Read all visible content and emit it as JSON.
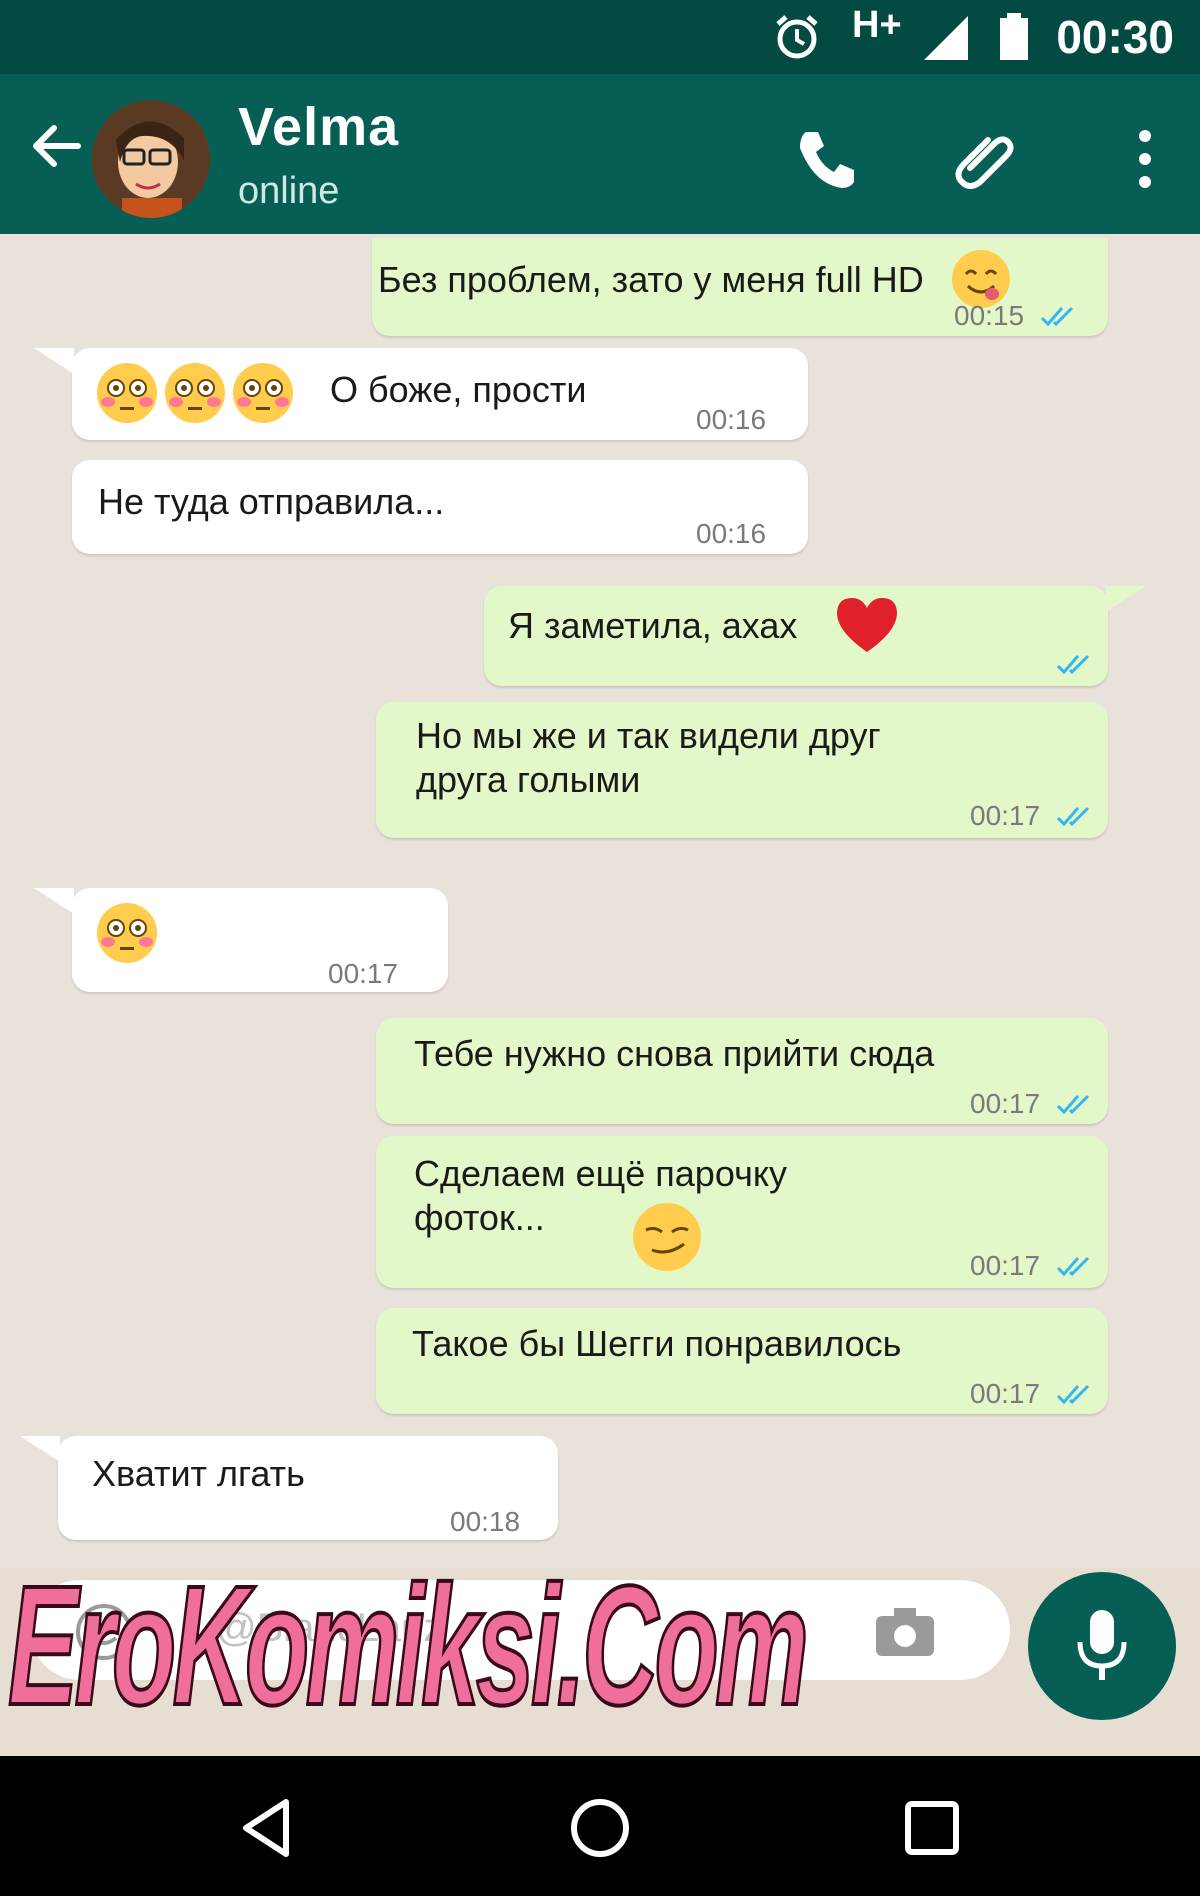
{
  "status_bar": {
    "time": "00:30",
    "network": "H+"
  },
  "header": {
    "contact_name": "Velma",
    "contact_status": "online"
  },
  "messages": [
    {
      "dir": "out",
      "text": "Без проблем, зато у меня full HD",
      "time": "00:15",
      "emoji": "yum"
    },
    {
      "dir": "in",
      "text": "О боже, прости",
      "time": "00:16",
      "emoji": "flushed x3"
    },
    {
      "dir": "in",
      "text": "Не туда отправила...",
      "time": "00:16"
    },
    {
      "dir": "out",
      "text": "Я заметила, ахах",
      "time": "",
      "emoji": "red-heart"
    },
    {
      "dir": "out",
      "text": "Но мы же и так видели друг друга голыми",
      "time": "00:17"
    },
    {
      "dir": "in",
      "text": "",
      "time": "00:17",
      "emoji": "flushed"
    },
    {
      "dir": "out",
      "text": "Тебе нужно снова прийти сюда",
      "time": "00:17"
    },
    {
      "dir": "out",
      "text": "Сделаем ещё парочку фоток...",
      "time": "00:17",
      "emoji": "smirk"
    },
    {
      "dir": "out",
      "text": "Такое бы Шегги понравилось",
      "time": "00:17"
    },
    {
      "dir": "in",
      "text": "Хватит лгать",
      "time": "00:18"
    }
  ],
  "input": {
    "placeholder": "@BlancLauz"
  },
  "watermark": "EroKomiksi.Com",
  "colors": {
    "header": "#075e54",
    "status_bar": "#034b42",
    "outgoing": "#e3f8c9",
    "incoming": "#ffffff",
    "background": "#e9e2da",
    "read_ticks": "#34b7f1"
  }
}
